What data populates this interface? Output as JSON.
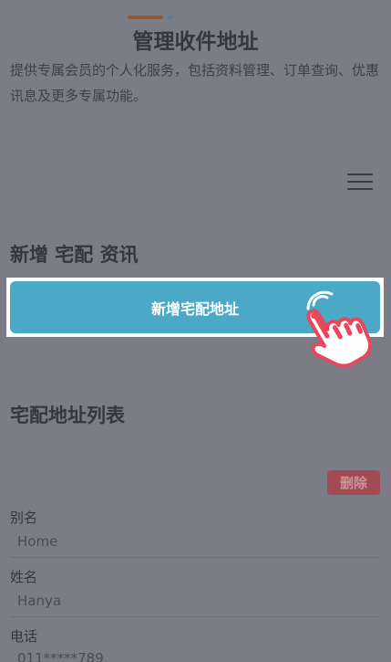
{
  "header": {
    "title": "管理收件地址",
    "description": "提供专属会员的个人化服务，包括资料管理、订单查询、优惠讯息及更多专属功能。"
  },
  "menu": {
    "icon": "hamburger-menu-icon"
  },
  "new_section": {
    "heading": "新增 宅配 资讯",
    "add_button_label": "新增宅配地址"
  },
  "list_section": {
    "heading": "宅配地址列表",
    "delete_label": "删除",
    "fields": [
      {
        "label": "别名",
        "value": "Home"
      },
      {
        "label": "姓名",
        "value": "Hanya"
      },
      {
        "label": "电话",
        "value": "011*****789"
      }
    ]
  },
  "colors": {
    "overlay_background": "#7b7c85",
    "accent_button": "#4ba8c6",
    "delete_button": "#a24b53",
    "pointer_icon": "#e8485a"
  }
}
